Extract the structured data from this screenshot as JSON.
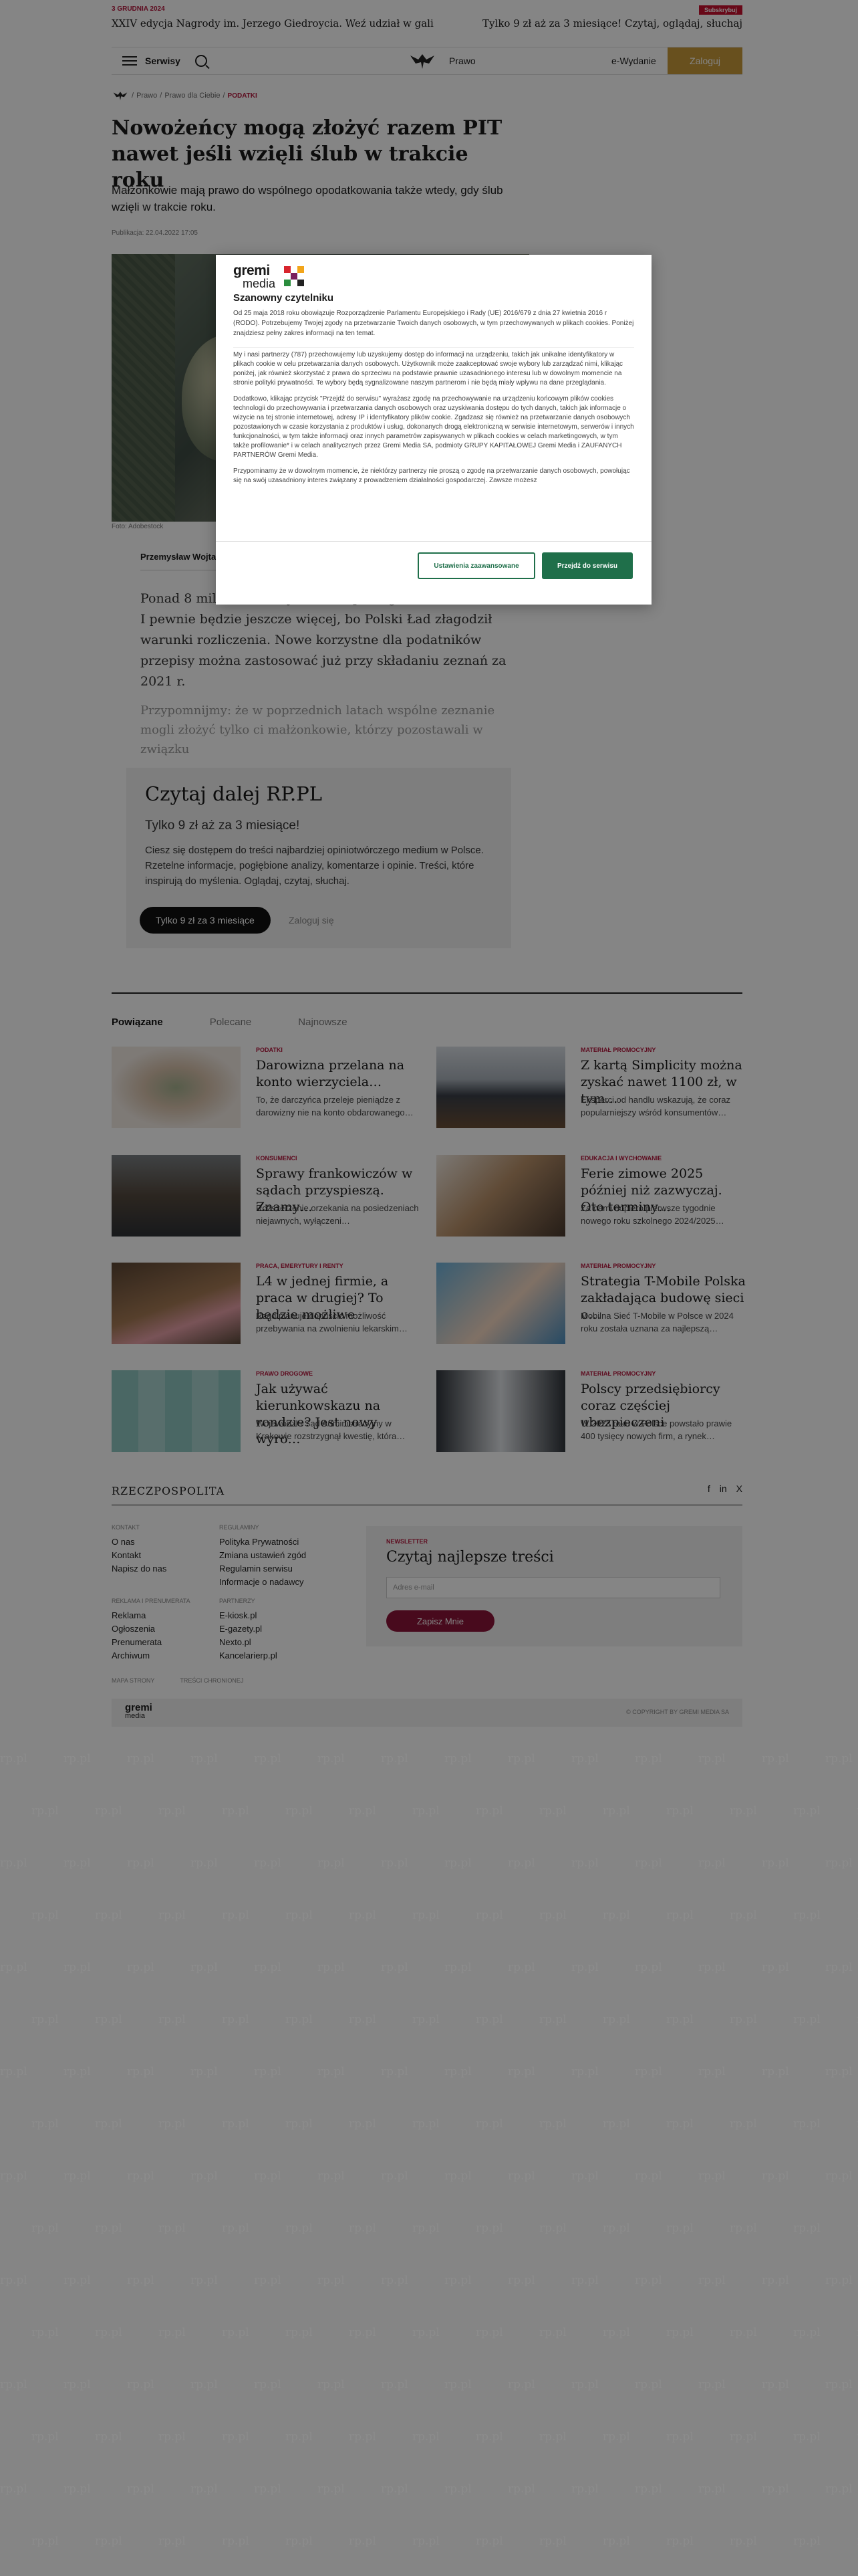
{
  "promo": {
    "date": "3 grudnia 2024",
    "headline": "XXIV edycja Nagrody im. Jerzego Giedroycia. Weź udział w gali",
    "badge": "Subskrybuj",
    "offer": "Tylko 9 zł  aż za 3 miesiące! Czytaj, oglądaj, słuchaj"
  },
  "header": {
    "menu_label": "Serwisy",
    "section": "Prawo",
    "edition": "e-Wydanie",
    "login": "Zaloguj"
  },
  "breadcrumb": [
    "Prawo",
    "Prawo dla Ciebie",
    "Podatki"
  ],
  "article": {
    "title": "Nowożeńcy mogą złożyć razem PIT nawet jeśli wzięli ślub w trakcie roku",
    "lead": "Małżonkowie mają prawo do wspólnego opodatkowania także wtedy, gdy ślub wzięli w trakcie roku.",
    "published": "Publikacja: 22.04.2022 17:05",
    "photo_caption": "Foto: Adobestock",
    "author": "Przemysław Wojtasik",
    "paragraph1": "Ponad 8 milionów korzysta ze wspólnego rozliczenia PIT. I pewnie będzie jeszcze więcej, bo Polski Ład złagodził warunki rozliczenia. Nowe korzystne dla podatników przepisy można zastosować już przy składaniu zeznań za 2021 r.",
    "paragraph2": "Przypomnijmy: że w poprzednich latach wspólne zeznanie mogli złożyć tylko ci małżonkowie, którzy pozostawali w związku"
  },
  "paywall": {
    "title": "Czytaj dalej RP.PL",
    "subtitle": "Tylko 9 zł aż za 3 miesiące!",
    "text": "Ciesz się dostępem do treści najbardziej opiniotwórczego medium w Polsce. Rzetelne informacje, pogłębione analizy, komentarze i opinie. Treści, które inspirują do myślenia. Oglądaj, czytaj, słuchaj.",
    "button": "Tylko 9 zł za 3 miesiące",
    "login": "Zaloguj się"
  },
  "tabs": [
    "Powiązane",
    "Polecane",
    "Najnowsze"
  ],
  "related": [
    {
      "category": "Podatki",
      "title": "Darowizna przelana na konto wierzyciela…",
      "desc": "To, że darczyńca przeleje pieniądze z darowizny nie na konto obdarowanego…"
    },
    {
      "category": "Materiał Promocyjny",
      "title": "Z kartą Simplicity można zyskać nawet 1100 zł, w tym…",
      "desc": "Eksperci od handlu wskazują, że coraz popularniejszy wśród konsumentów…"
    },
    {
      "category": "Konsumenci",
      "title": "Sprawy frankowiczów w sądach przyspieszą. Znamy…",
      "desc": "Rozszerzenie orzekania na posiedzeniach niejawnych, wyłączeni…"
    },
    {
      "category": "Edukacja i wychowanie",
      "title": "Ferie zimowe 2025 później niż zazwyczaj. Oto terminy…",
      "desc": "Za nami dopiero pierwsze tygodnie nowego roku szkolnego 2024/2025…"
    },
    {
      "category": "Praca, Emerytury i renty",
      "title": "L4 w jednej firmie, a praca w drugiej? To będzie możliwe",
      "desc": "Rząd planuje dopuścić możliwość przebywania na zwolnieniu lekarskim…"
    },
    {
      "category": "Materiał Promocyjny",
      "title": "Strategia T-Mobile Polska zakładająca budowę sieci o…",
      "desc": "Mobilna Sieć T-Mobile w Polsce w 2024 roku została uznana za najlepszą…"
    },
    {
      "category": "Prawo drogowe",
      "title": "Jak używać kierunkowskazu na rondzie? Jest nowy wyro…",
      "desc": "Wojewódzki Sąd Administracyjny w Krakowie rozstrzygnął kwestię, która…"
    },
    {
      "category": "Materiał Promocyjny",
      "title": "Polscy przedsiębiorcy coraz częściej ubezpieczeni",
      "desc": "W 2023 roku w Polsce powstało prawie 400 tysięcy nowych firm, a rynek…"
    }
  ],
  "footer": {
    "logo": "RZECZPOSPOLITA",
    "social": [
      "f",
      "in",
      "X"
    ],
    "col1_head": "Kontakt",
    "col1": [
      "O nas",
      "Kontakt",
      "Napisz do nas"
    ],
    "col2_head": "Regulaminy",
    "col2": [
      "Polityka Prywatności",
      "Zmiana ustawień zgód",
      "Regulamin serwisu",
      "Informacje o nadawcy"
    ],
    "col3_head": "Reklama i prenumerata",
    "col3": [
      "Reklama",
      "Ogłoszenia",
      "Prenumerata",
      "Archiwum"
    ],
    "col4_head": "Partnerzy",
    "col4": [
      "E-kiosk.pl",
      "E-gazety.pl",
      "Nexto.pl",
      "Kancelarierp.pl"
    ],
    "newsletter_head": "Newsletter",
    "newsletter_title": "Czytaj najlepsze treści",
    "newsletter_placeholder": "Adres e-mail",
    "newsletter_button": "Zapisz Mnie",
    "bottom_links": [
      "Mapa strony",
      "Treści chronionej"
    ],
    "gremi_name": "gremi",
    "gremi_sub": "media",
    "copyright": "© Copyright by Gremi Media SA"
  },
  "watermark_text": "rp.pl",
  "consent": {
    "logo_word": "gremi",
    "logo_sub": "media",
    "hello": "Szanowny czytelniku",
    "intro": "Od 25 maja 2018 roku obowiązuje Rozporządzenie Parlamentu Europejskiego i Rady (UE) 2016/679 z dnia 27 kwietnia 2016 r (RODO). Potrzebujemy Twojej zgody na przetwarzanie Twoich danych osobowych, w tym przechowywanych w plikach cookies. Poniżej znajdziesz pełny zakres informacji na ten temat.",
    "para1": "My i nasi partnerzy (787) przechowujemy lub uzyskujemy dostęp do informacji na urządzeniu, takich jak unikalne identyfikatory w plikach cookie w celu przetwarzania danych osobowych. Użytkownik może zaakceptować swoje wybory lub zarządzać nimi, klikając poniżej, jak również skorzystać z prawa do sprzeciwu na podstawie prawnie uzasadnionego interesu lub w dowolnym momencie na stronie polityki prywatności. Te wybory będą sygnalizowane naszym partnerom i nie będą miały wpływu na dane przeglądania.",
    "para2": "Dodatkowo, klikając przycisk \"Przejdź do serwisu\" wyrażasz zgodę na przechowywanie na urządzeniu końcowym plików cookies technologii do przechowywania i przetwarzania danych osobowych oraz uzyskiwania dostępu do tych danych, takich jak informacje o wizycie na tej stronie internetowej, adresy IP i identyfikatory plików cookie. Zgadzasz się również na przetwarzanie danych osobowych pozostawionych w czasie korzystania z produktów i usług, dokonanych drogą elektroniczną w serwisie internetowym, serwerów i innych funkcjonalności, w tym także informacji oraz innych parametrów zapisywanych w plikach cookies w celach marketingowych, w tym także profilowanie* i w celach analitycznych przez Gremi Media SA, podmioty GRUPY KAPITAŁOWEJ Gremi Media i ZAUFANYCH PARTNERÓW Gremi Media.",
    "para3": "Przypominamy że w dowolnym momencie, że niektórzy partnerzy nie proszą o zgodę na przetwarzanie danych osobowych, powołując się na swój uzasadniony interes związany z prowadzeniem działalności gospodarczej. Zawsze możesz",
    "btn_advanced": "Ustawienia zaawansowane",
    "btn_accept": "Przejdź do serwisu"
  }
}
